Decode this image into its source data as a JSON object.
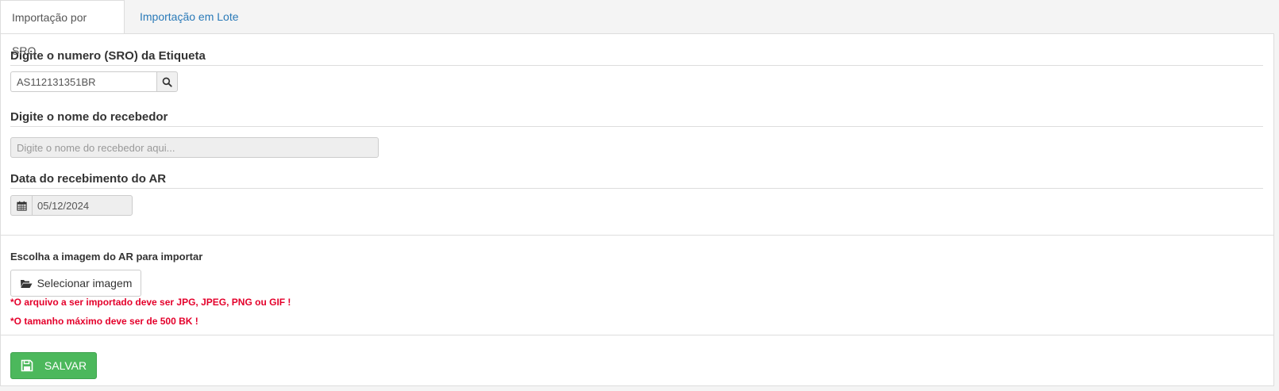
{
  "tabs": {
    "sro": "Importação por SRO",
    "lote": "Importação em Lote"
  },
  "sro": {
    "title": "Digite o numero (SRO) da Etiqueta",
    "value": "AS112131351BR"
  },
  "recebedor": {
    "title": "Digite o nome do recebedor",
    "placeholder": "Digite o nome do recebedor aqui..."
  },
  "recebimento": {
    "title": "Data do recebimento do AR",
    "value": "05/12/2024"
  },
  "upload": {
    "label": "Escolha a imagem do AR para importar",
    "button": "Selecionar imagem",
    "note_formats": "*O arquivo a ser importado deve ser JPG, JPEG, PNG ou GIF !",
    "note_size": "*O tamanho máximo deve ser de 500 BK !"
  },
  "actions": {
    "save": "SALVAR"
  },
  "colors": {
    "link": "#2a7ab8",
    "save": "#4cb85c",
    "warning": "#e4002b"
  },
  "icons": [
    "search-icon",
    "calendar-icon",
    "folder-open-icon",
    "save-icon"
  ]
}
